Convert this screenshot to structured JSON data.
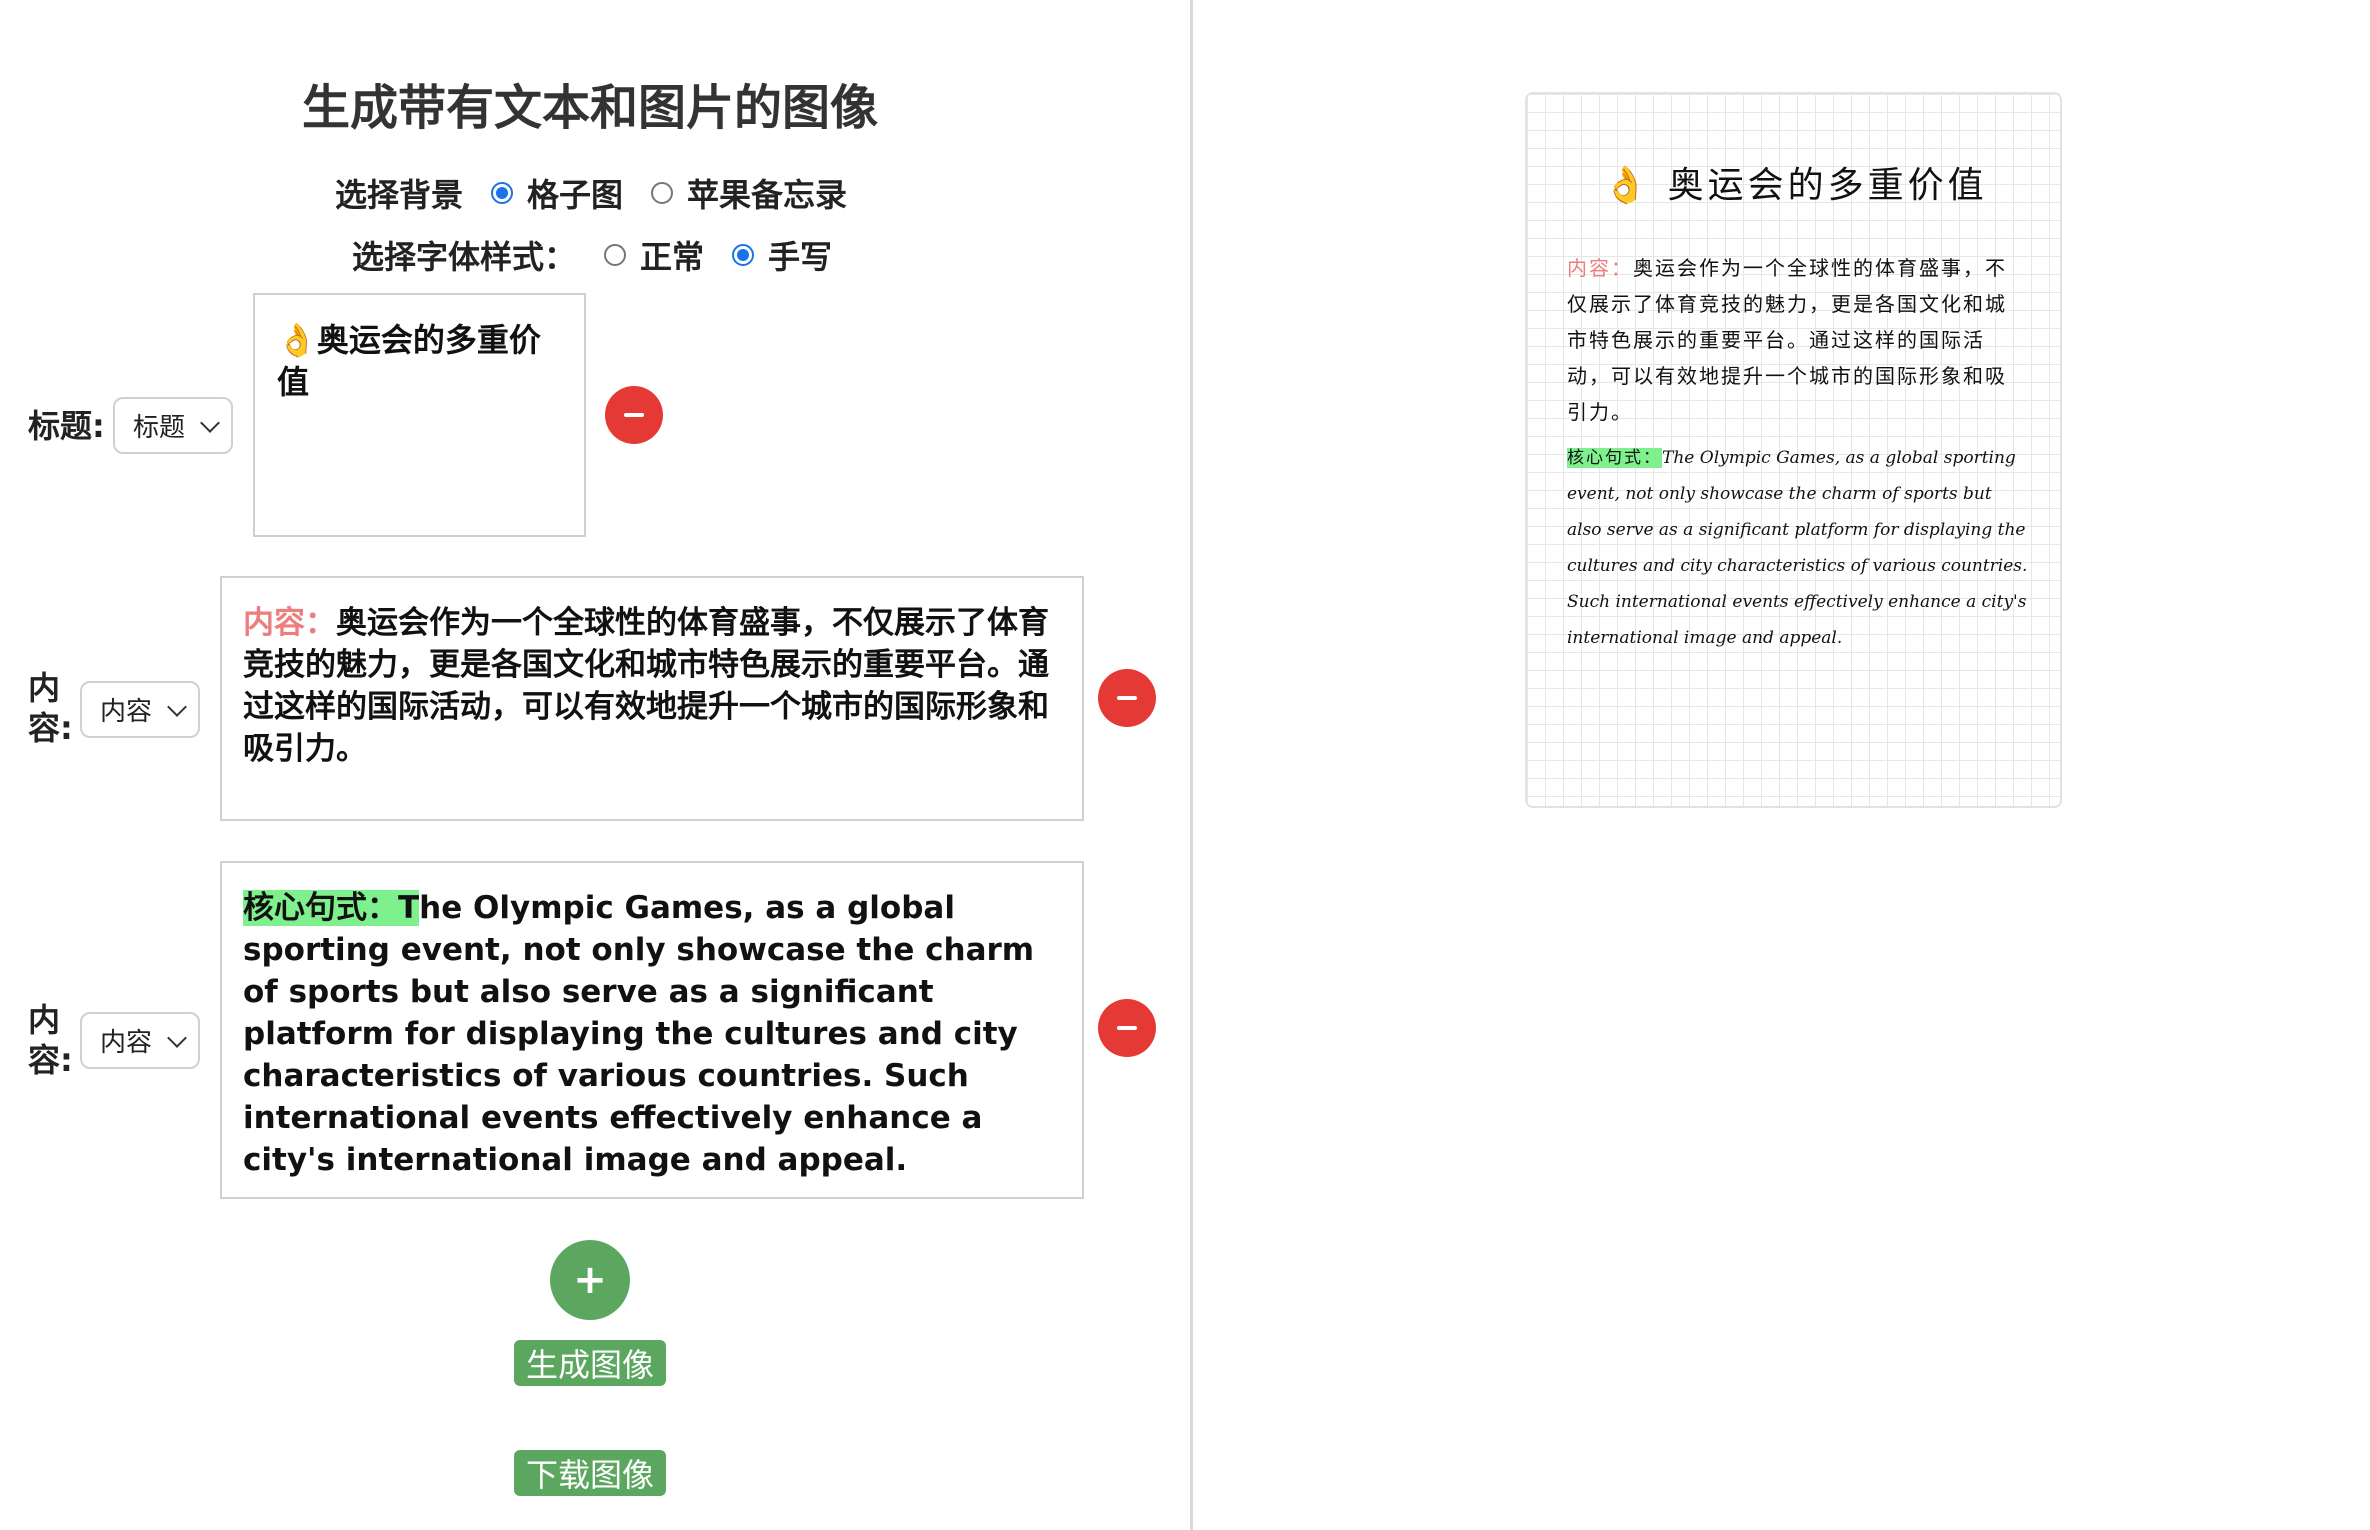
{
  "page": {
    "title": "生成带有文本和图片的图像"
  },
  "background": {
    "label": "选择背景",
    "options": [
      {
        "label": "格子图",
        "selected": true
      },
      {
        "label": "苹果备忘录",
        "selected": false
      }
    ]
  },
  "font_style": {
    "label": "选择字体样式：",
    "options": [
      {
        "label": "正常",
        "selected": false
      },
      {
        "label": "手写",
        "selected": true
      }
    ]
  },
  "blocks": [
    {
      "label": "标题:",
      "type_value": "标题",
      "text": "👌奥运会的多重价值"
    },
    {
      "label": "内容:",
      "type_value": "内容",
      "prefix": "内容：",
      "text": "奥运会作为一个全球性的体育盛事，不仅展示了体育竞技的魅力，更是各国文化和城市特色展示的重要平台。通过这样的国际活动，可以有效地提升一个城市的国际形象和吸引力。"
    },
    {
      "label": "内容:",
      "type_value": "内容",
      "prefix": "核心句式：T",
      "text": "he Olympic Games, as a global sporting event, not only showcase the charm of sports but also serve as a significant platform for displaying the cultures and city characteristics of various countries. Such international events effectively enhance a city's international image and appeal."
    }
  ],
  "actions": {
    "add": "+",
    "generate": "生成图像",
    "download": "下载图像"
  },
  "preview": {
    "title": "👌 奥运会的多重价值",
    "p1_prefix": "内容：",
    "p1_text": "奥运会作为一个全球性的体育盛事，不仅展示了体育竞技的魅力，更是各国文化和城市特色展示的重要平台。通过这样的国际活动，可以有效地提升一个城市的国际形象和吸引力。",
    "p2_prefix": "核心句式：",
    "p2_text": "The Olympic Games, as a global sporting event, not only showcase the charm of sports but also serve as a significant platform for displaying the cultures and city characteristics of various countries. Such international events effectively enhance a city's international image and appeal."
  },
  "colors": {
    "accent_radio": "#1a73e8",
    "remove_button": "#e53935",
    "action_green": "#5ca760",
    "prefix_red": "#ec7e7e",
    "highlight_green": "#7ef08d"
  }
}
